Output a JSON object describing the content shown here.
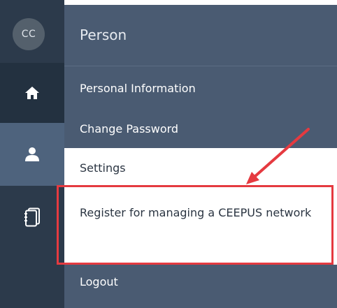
{
  "avatar": {
    "initials": "CC"
  },
  "panel": {
    "title": "Person"
  },
  "rail": {
    "items": [
      {
        "icon": "home-icon"
      },
      {
        "icon": "user-icon",
        "active": true
      },
      {
        "icon": "book-icon"
      }
    ]
  },
  "menu": {
    "personal_information": "Personal Information",
    "change_password": "Change Password",
    "settings": "Settings",
    "register": "Register for managing a CEEPUS network",
    "logout": "Logout"
  },
  "annotation": {
    "color": "#e53a40"
  },
  "colors": {
    "rail_bg": "#2c3a4b",
    "panel_bg": "#4a5b72",
    "active_rail": "#4e637d"
  }
}
